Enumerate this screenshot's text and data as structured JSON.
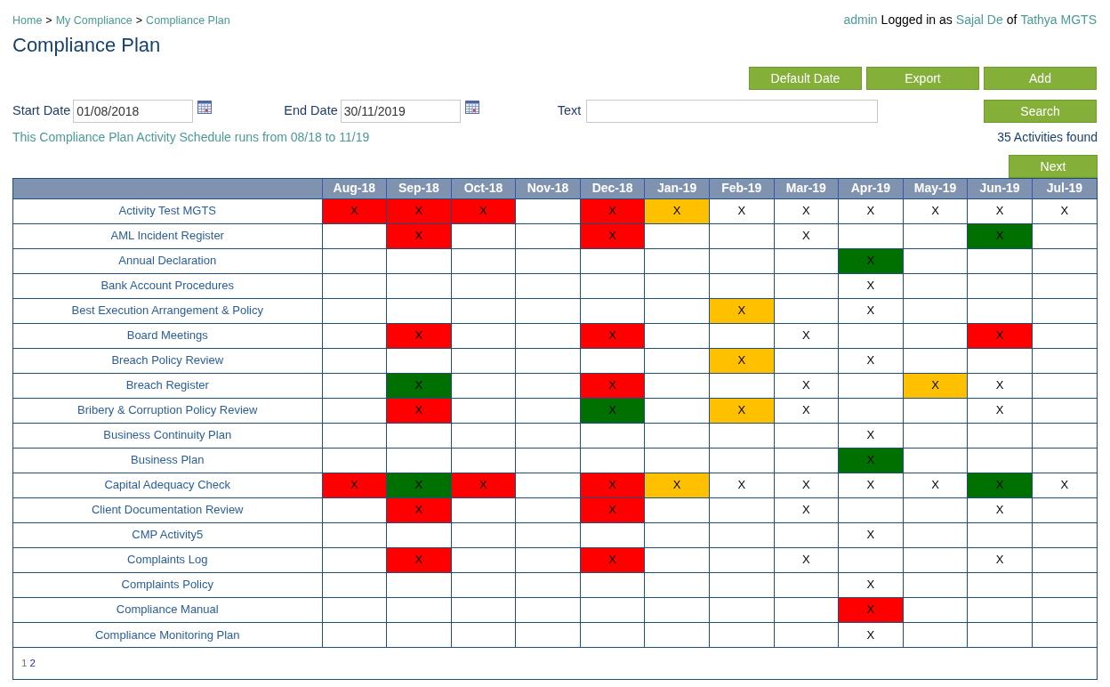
{
  "breadcrumb": [
    {
      "label": "Home"
    },
    {
      "label": "My Compliance"
    },
    {
      "label": "Compliance Plan"
    }
  ],
  "breadcrumb_separator": ">",
  "user_bar": {
    "role": "admin",
    "text_1": "Logged in as",
    "user": "Sajal De",
    "text_2": "of",
    "company": "Tathya MGTS"
  },
  "title": "Compliance Plan",
  "buttons": [
    "Default Date",
    "Export",
    "Add"
  ],
  "filters": {
    "start_date_label": "Start Date",
    "start_date": "01/08/2018",
    "end_date_label": "End Date",
    "end_date": "30/11/2019",
    "text_label": "Text",
    "search_button": "Search"
  },
  "schedule_note": "This Compliance Plan Activity Schedule runs from 08/18 to 11/19",
  "found": "35 Activities found",
  "next_button": "Next",
  "table": {
    "columns": [
      "Aug-18",
      "Sep-18",
      "Oct-18",
      "Nov-18",
      "Dec-18",
      "Jan-19",
      "Feb-19",
      "Mar-19",
      "Apr-19",
      "May-19",
      "Jun-19",
      "Jul-19"
    ],
    "rows": [
      {
        "name": "Activity Test MGTS",
        "cells": [
          {
            "text": "X",
            "color": "#ff0000"
          },
          {
            "text": "X",
            "color": "#ff0000"
          },
          {
            "text": "X",
            "color": "#ff0000"
          },
          {},
          {
            "text": "X",
            "color": "#ff0000"
          },
          {
            "text": "X",
            "color": "#ffc000"
          },
          {
            "text": "X"
          },
          {
            "text": "X"
          },
          {
            "text": "X"
          },
          {
            "text": "X"
          },
          {
            "text": "X"
          },
          {
            "text": "X"
          }
        ]
      },
      {
        "name": "AML Incident Register",
        "cells": [
          {},
          {
            "text": "X",
            "color": "#ff0000"
          },
          {},
          {},
          {
            "text": "X",
            "color": "#ff0000"
          },
          {},
          {},
          {
            "text": "X"
          },
          {},
          {},
          {
            "text": "X",
            "color": "#007000"
          },
          {}
        ]
      },
      {
        "name": "Annual Declaration",
        "cells": [
          {},
          {},
          {},
          {},
          {},
          {},
          {},
          {},
          {
            "text": "X",
            "color": "#007000"
          },
          {},
          {},
          {}
        ]
      },
      {
        "name": "Bank Account Procedures",
        "cells": [
          {},
          {},
          {},
          {},
          {},
          {},
          {},
          {},
          {
            "text": "X"
          },
          {},
          {},
          {}
        ]
      },
      {
        "name": "Best Execution Arrangement & Policy",
        "cells": [
          {},
          {},
          {},
          {},
          {},
          {},
          {
            "text": "X",
            "color": "#ffc000"
          },
          {},
          {
            "text": "X"
          },
          {},
          {},
          {}
        ]
      },
      {
        "name": "Board Meetings",
        "cells": [
          {},
          {
            "text": "X",
            "color": "#ff0000"
          },
          {},
          {},
          {
            "text": "X",
            "color": "#ff0000"
          },
          {},
          {},
          {
            "text": "X"
          },
          {},
          {},
          {
            "text": "X",
            "color": "#ff0000"
          },
          {}
        ]
      },
      {
        "name": "Breach Policy Review",
        "cells": [
          {},
          {},
          {},
          {},
          {},
          {},
          {
            "text": "X",
            "color": "#ffc000"
          },
          {},
          {
            "text": "X"
          },
          {},
          {},
          {}
        ]
      },
      {
        "name": "Breach Register",
        "cells": [
          {},
          {
            "text": "X",
            "color": "#007000"
          },
          {},
          {},
          {
            "text": "X",
            "color": "#ff0000"
          },
          {},
          {},
          {
            "text": "X"
          },
          {},
          {
            "text": "X",
            "color": "#ffc000"
          },
          {
            "text": "X"
          },
          {}
        ]
      },
      {
        "name": "Bribery & Corruption Policy Review",
        "cells": [
          {},
          {
            "text": "X",
            "color": "#ff0000"
          },
          {},
          {},
          {
            "text": "X",
            "color": "#007000"
          },
          {},
          {
            "text": "X",
            "color": "#ffc000"
          },
          {
            "text": "X"
          },
          {},
          {},
          {
            "text": "X"
          },
          {}
        ]
      },
      {
        "name": "Business Continuity Plan",
        "cells": [
          {},
          {},
          {},
          {},
          {},
          {},
          {},
          {},
          {
            "text": "X"
          },
          {},
          {},
          {}
        ]
      },
      {
        "name": "Business Plan",
        "cells": [
          {},
          {},
          {},
          {},
          {},
          {},
          {},
          {},
          {
            "text": "X",
            "color": "#007000"
          },
          {},
          {},
          {}
        ]
      },
      {
        "name": "Capital Adequacy Check",
        "cells": [
          {
            "text": "X",
            "color": "#ff0000"
          },
          {
            "text": "X",
            "color": "#007000"
          },
          {
            "text": "X",
            "color": "#ff0000"
          },
          {},
          {
            "text": "X",
            "color": "#ff0000"
          },
          {
            "text": "X",
            "color": "#ffc000"
          },
          {
            "text": "X"
          },
          {
            "text": "X"
          },
          {
            "text": "X"
          },
          {
            "text": "X"
          },
          {
            "text": "X",
            "color": "#007000"
          },
          {
            "text": "X"
          }
        ]
      },
      {
        "name": "Client Documentation Review",
        "cells": [
          {},
          {
            "text": "X",
            "color": "#ff0000"
          },
          {},
          {},
          {
            "text": "X",
            "color": "#ff0000"
          },
          {},
          {},
          {
            "text": "X"
          },
          {},
          {},
          {
            "text": "X"
          },
          {}
        ]
      },
      {
        "name": "CMP Activity5",
        "cells": [
          {},
          {},
          {},
          {},
          {},
          {},
          {},
          {},
          {
            "text": "X"
          },
          {},
          {},
          {}
        ]
      },
      {
        "name": "Complaints Log",
        "cells": [
          {},
          {
            "text": "X",
            "color": "#ff0000"
          },
          {},
          {},
          {
            "text": "X",
            "color": "#ff0000"
          },
          {},
          {},
          {
            "text": "X"
          },
          {},
          {},
          {
            "text": "X"
          },
          {}
        ]
      },
      {
        "name": "Complaints Policy",
        "cells": [
          {},
          {},
          {},
          {},
          {},
          {},
          {},
          {},
          {
            "text": "X"
          },
          {},
          {},
          {}
        ]
      },
      {
        "name": "Compliance Manual",
        "cells": [
          {},
          {},
          {},
          {},
          {},
          {},
          {},
          {},
          {
            "text": "X",
            "color": "#ff0000"
          },
          {},
          {},
          {}
        ]
      },
      {
        "name": "Compliance Monitoring Plan",
        "cells": [
          {},
          {},
          {},
          {},
          {},
          {},
          {},
          {},
          {
            "text": "X"
          },
          {},
          {},
          {}
        ]
      }
    ]
  },
  "pagination": [
    {
      "label": "1",
      "selected": true
    },
    {
      "label": "2",
      "selected": false
    }
  ]
}
